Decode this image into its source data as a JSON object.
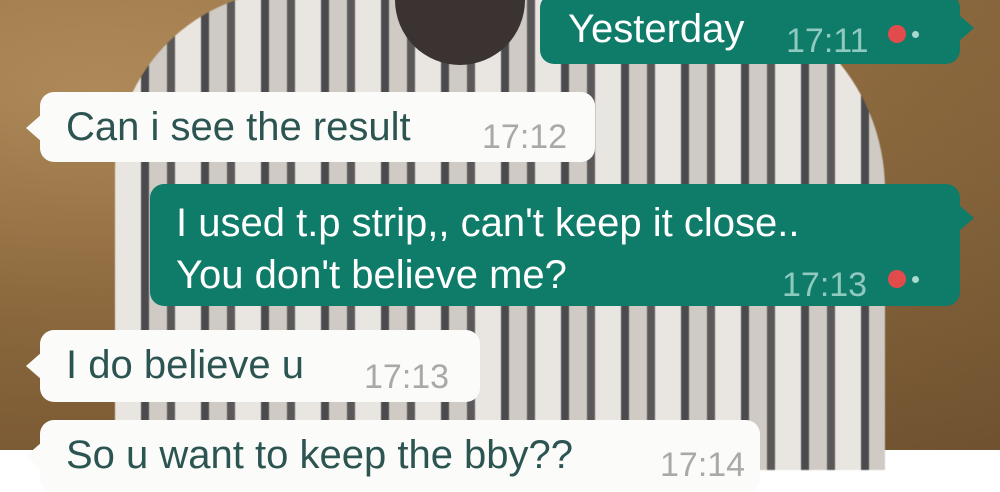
{
  "messages": [
    {
      "type": "outgoing",
      "text": "Yesterday",
      "time": "17:11"
    },
    {
      "type": "incoming",
      "text": "Can i see the result",
      "time": "17:12"
    },
    {
      "type": "outgoing",
      "line1": "I used t.p strip,, can't keep it close..",
      "line2": "You don't believe me?",
      "time": "17:13"
    },
    {
      "type": "incoming",
      "text": "I do believe u",
      "time": "17:13"
    },
    {
      "type": "incoming",
      "text": "So u want to keep the bby??",
      "time": "17:14"
    }
  ],
  "colors": {
    "outgoing_bubble": "#0f7b69",
    "incoming_bubble": "#fbfbfa",
    "tick_red": "#e24b4b"
  }
}
